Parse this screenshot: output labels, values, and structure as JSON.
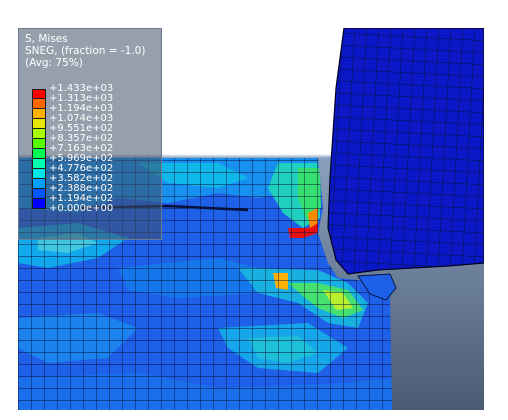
{
  "legend": {
    "line1": "S, Mises",
    "line2": "SNEG, (fraction = -1.0)",
    "line3": "(Avg: 75%)",
    "values": [
      "+1.433e+03",
      "+1.313e+03",
      "+1.194e+03",
      "+1.074e+03",
      "+9.551e+02",
      "+8.357e+02",
      "+7.163e+02",
      "+5.969e+02",
      "+4.776e+02",
      "+3.582e+02",
      "+2.388e+02",
      "+1.194e+02",
      "+0.000e+00"
    ],
    "colors": [
      "#ff0000",
      "#ff6600",
      "#ffb000",
      "#e6e600",
      "#a8ff00",
      "#55ff00",
      "#00ff55",
      "#00ffb0",
      "#00e6e6",
      "#00a0ff",
      "#0055ff",
      "#0000ff"
    ]
  },
  "scene": {
    "background_top": "#ffffff",
    "background_bottom": "#5a6a82",
    "workpiece_base": "#1f60e8",
    "tool_color": "#0b18c8",
    "mesh_line": "#0a0a30"
  }
}
